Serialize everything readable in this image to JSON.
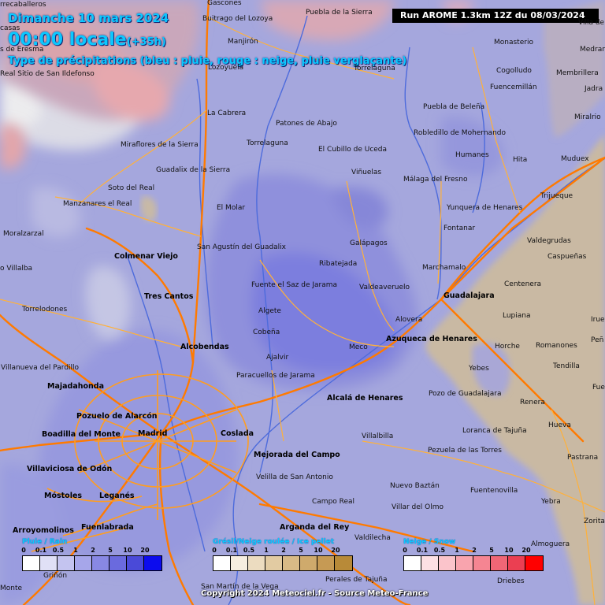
{
  "header": {
    "date_line": "Dimanche 10 mars 2024",
    "time_line": "00:00 locale",
    "offset": "(+35h)",
    "type_line": "Type de précipitations (bleu : pluie, rouge : neige, pluie verglaçante)",
    "run_info": "Run AROME 1.3km 12Z du 08/03/2024"
  },
  "places": {
    "robregordo": "rrecaballeros",
    "gascones": "Gascones",
    "buitrago": "Buitrago del Lozoya",
    "puebla_sierra": "Puebla de la Sierra",
    "casas": "casas",
    "eresma": "s de Eresma",
    "manjiron": "Manjirón",
    "monasterio": "Monasterio",
    "medranda": "Medran",
    "villa_sy": "Villa de S",
    "lozoyuela": "Lozoyuela",
    "torrelaguna2": "Torrelaguna",
    "sanildefonso": "Real Sitio de San Ildefonso",
    "cogolludo": "Cogolludo",
    "membrillera": "Membrillera",
    "fuencemillan": "Fuencemillán",
    "jadraque": "Jadra",
    "cabrera": "La Cabrera",
    "puebla_belena": "Puebla de Beleña",
    "miralrio": "Miralrio",
    "patones": "Patones de Abajo",
    "robledillo": "Robledillo de Mohernando",
    "miraflores": "Miraflores de la Sierra",
    "torrelaguna": "Torrelaguna",
    "cubillo": "El Cubillo de Uceda",
    "humanes": "Humanes",
    "hita": "Hita",
    "muduex": "Muduex",
    "guadalix": "Guadalix de la Sierra",
    "vinuelas": "Viñuelas",
    "malaga_fresno": "Málaga del Fresno",
    "soto_real": "Soto del Real",
    "trijueque": "Trijueque",
    "manzanares": "Manzanares el Real",
    "el_molar": "El Molar",
    "yunquera": "Yunquera de Henares",
    "fontanar": "Fontanar",
    "moralzarzal": "Moralzarzal",
    "galapagos": "Galápagos",
    "valdegrudas": "Valdegrudas",
    "sanagustin": "San Agustín del Guadalix",
    "caspuenas": "Caspueñas",
    "colmenar": "Colmenar Viejo",
    "ribatejada": "Ribatejada",
    "marchamalo": "Marchamalo",
    "villalba": "o Villalba",
    "fuente_saz": "Fuente el Saz de Jarama",
    "valdeaveruelo": "Valdeaveruelo",
    "centenera": "Centenera",
    "tres_cantos": "Tres Cantos",
    "guadalajara": "Guadalajara",
    "torrelodones": "Torrelodones",
    "algete": "Algete",
    "lupiana": "Lupiana",
    "alovera": "Alovera",
    "irueste": "Irue",
    "cobena": "Cobeña",
    "azuqueca": "Azuqueca de Henares",
    "penalver": "Peñ",
    "alcobendas": "Alcobendas",
    "meco": "Meco",
    "horche": "Horche",
    "romanones": "Romanones",
    "ajalvir": "Ajalvir",
    "villanueva_pardillo": "Villanueva del Pardillo",
    "yebes": "Yebes",
    "tendilla": "Tendilla",
    "paracuellos": "Paracuellos de Jarama",
    "majadahonda": "Majadahonda",
    "fuentelencina": "Fue",
    "pozo_guadalajara": "Pozo de Guadalajara",
    "alcala": "Alcalá de Henares",
    "renera": "Renera",
    "pozuelo": "Pozuelo de Alarcón",
    "hueva": "Hueva",
    "boadilla": "Boadilla del Monte",
    "madrid": "Madrid",
    "coslada": "Coslada",
    "villalbilla": "Villalbilla",
    "loranca": "Loranca de Tajuña",
    "pezuela": "Pezuela de las Torres",
    "pastrana": "Pastrana",
    "mejorada": "Mejorada del Campo",
    "villaviciosa": "Villaviciosa de Odón",
    "velilla": "Velilla de San Antonio",
    "nuevo_baztan": "Nuevo Baztán",
    "fuentenovilla": "Fuentenovilla",
    "mostoles": "Móstoles",
    "leganes": "Leganés",
    "campo_real": "Campo Real",
    "villar_olmo": "Villar del Olmo",
    "yebra": "Yebra",
    "zorita": "Zorita",
    "arganda": "Arganda del Rey",
    "arroyomolinos": "Arroyomolinos",
    "fuenlabrada": "Fuenlabrada",
    "valdilecha": "Valdilecha",
    "almoguera": "Almoguera",
    "grinon": "Griñón",
    "perales": "Perales de Tajuña",
    "driebes": "Driebes",
    "mbrunete": "Monte",
    "sanmartin": "San Martín de la Vega"
  },
  "legend": {
    "rain": {
      "title": "Pluie / Rain",
      "ticks": [
        "0",
        "0.1",
        "0.5",
        "1",
        "2",
        "5",
        "10",
        "20"
      ],
      "colors": [
        "#ffffff",
        "#e0e0f6",
        "#c4c4f0",
        "#a6a6ea",
        "#8888e4",
        "#6a6ade",
        "#4a4ad8",
        "#0c0cee"
      ]
    },
    "ice": {
      "title": "Grésil/Neige roulée / Ice pellet",
      "ticks": [
        "0",
        "0.1",
        "0.5",
        "1",
        "2",
        "5",
        "10",
        "20"
      ],
      "colors": [
        "#ffffff",
        "#f6eee0",
        "#ecdcc0",
        "#e2cba2",
        "#d8ba86",
        "#cfaa6c",
        "#c69a54",
        "#b88a38"
      ]
    },
    "snow": {
      "title": "Neige / Snow",
      "ticks": [
        "0",
        "0.1",
        "0.5",
        "1",
        "2",
        "5",
        "10",
        "20"
      ],
      "colors": [
        "#ffffff",
        "#fde0e4",
        "#fbc4cb",
        "#f9a4ae",
        "#f58592",
        "#f06676",
        "#eb3f52",
        "#ff0000"
      ]
    }
  },
  "copyright": "Copyright 2024 Meteociel.fr - Source Meteo-France"
}
